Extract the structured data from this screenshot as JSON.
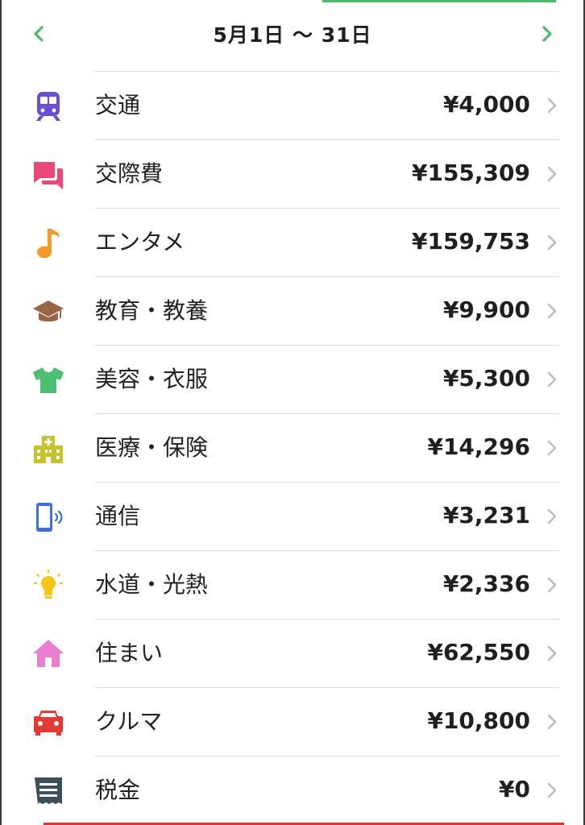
{
  "header": {
    "period": "5月1日 〜 31日"
  },
  "colors": {
    "accent": "#52b96a",
    "chevron": "#bdbdbd",
    "divider": "#d9d9d9"
  },
  "categories": [
    {
      "label": "交通",
      "amount": "¥4,000",
      "icon": "train-icon",
      "color": "#6b4fcf"
    },
    {
      "label": "交際費",
      "amount": "¥155,309",
      "icon": "chat-bubbles-icon",
      "color": "#e8487a"
    },
    {
      "label": "エンタメ",
      "amount": "¥159,753",
      "icon": "music-note-icon",
      "color": "#f39a28"
    },
    {
      "label": "教育・教養",
      "amount": "¥9,900",
      "icon": "graduation-cap-icon",
      "color": "#9a6447"
    },
    {
      "label": "美容・衣服",
      "amount": "¥5,300",
      "icon": "tshirt-icon",
      "color": "#4cbf73"
    },
    {
      "label": "医療・保険",
      "amount": "¥14,296",
      "icon": "hospital-icon",
      "color": "#c7c22c"
    },
    {
      "label": "通信",
      "amount": "¥3,231",
      "icon": "smartphone-icon",
      "color": "#3f6fd8"
    },
    {
      "label": "水道・光熱",
      "amount": "¥2,336",
      "icon": "light-bulb-icon",
      "color": "#f5c518"
    },
    {
      "label": "住まい",
      "amount": "¥62,550",
      "icon": "house-icon",
      "color": "#ea7fd0"
    },
    {
      "label": "クルマ",
      "amount": "¥10,800",
      "icon": "car-icon",
      "color": "#e53935"
    },
    {
      "label": "税金",
      "amount": "¥0",
      "icon": "receipt-icon",
      "color": "#3d4f5a"
    }
  ]
}
